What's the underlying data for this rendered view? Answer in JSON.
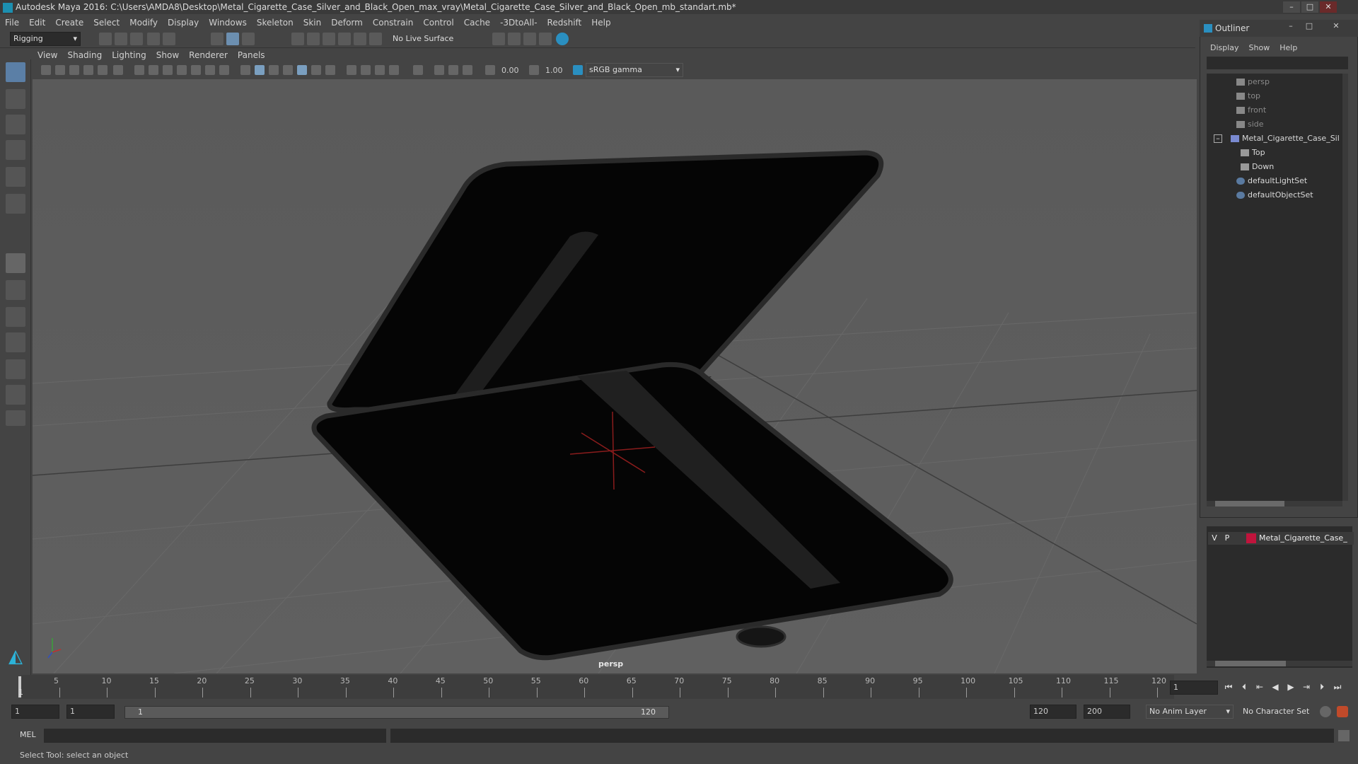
{
  "window": {
    "title": "Autodesk Maya 2016: C:\\Users\\AMDA8\\Desktop\\Metal_Cigarette_Case_Silver_and_Black_Open_max_vray\\Metal_Cigarette_Case_Silver_and_Black_Open_mb_standart.mb*",
    "minimize": "–",
    "maximize": "□",
    "close": "✕"
  },
  "menubar": [
    "File",
    "Edit",
    "Create",
    "Select",
    "Modify",
    "Display",
    "Windows",
    "Skeleton",
    "Skin",
    "Deform",
    "Constrain",
    "Control",
    "Cache",
    "-3DtoAll-",
    "Redshift",
    "Help"
  ],
  "shelf": {
    "mode": "Rigging",
    "live_surface": "No Live Surface"
  },
  "viewport": {
    "menus": [
      "View",
      "Shading",
      "Lighting",
      "Show",
      "Renderer",
      "Panels"
    ],
    "exposure": "0.00",
    "gamma": "1.00",
    "color_space": "sRGB gamma",
    "camera_label": "persp"
  },
  "outliner": {
    "title": "Outliner",
    "menus": [
      "Display",
      "Show",
      "Help"
    ],
    "items": [
      {
        "label": "persp",
        "dim": true
      },
      {
        "label": "top",
        "dim": true
      },
      {
        "label": "front",
        "dim": true
      },
      {
        "label": "side",
        "dim": true
      },
      {
        "label": "Metal_Cigarette_Case_Sil",
        "dim": false
      },
      {
        "label": "Top",
        "dim": false
      },
      {
        "label": "Down",
        "dim": false
      },
      {
        "label": "defaultLightSet",
        "dim": false
      },
      {
        "label": "defaultObjectSet",
        "dim": false
      }
    ]
  },
  "layers": {
    "v": "V",
    "p": "P",
    "name": "Metal_Cigarette_Case_",
    "color": "#c0143c"
  },
  "timeline": {
    "ticks": [
      "5",
      "10",
      "15",
      "20",
      "25",
      "30",
      "35",
      "40",
      "45",
      "50",
      "55",
      "60",
      "65",
      "70",
      "75",
      "80",
      "85",
      "90",
      "95",
      "100",
      "105",
      "110",
      "115",
      "120"
    ],
    "start_marker": "1",
    "current_frame": "1"
  },
  "range": {
    "start": "1",
    "playback_start": "1",
    "slider_start": "1",
    "slider_end": "120",
    "playback_end": "120",
    "end": "200",
    "anim_layer": "No Anim Layer",
    "character_set": "No Character Set"
  },
  "command": {
    "label": "MEL"
  },
  "help_line": "Select Tool: select an object"
}
